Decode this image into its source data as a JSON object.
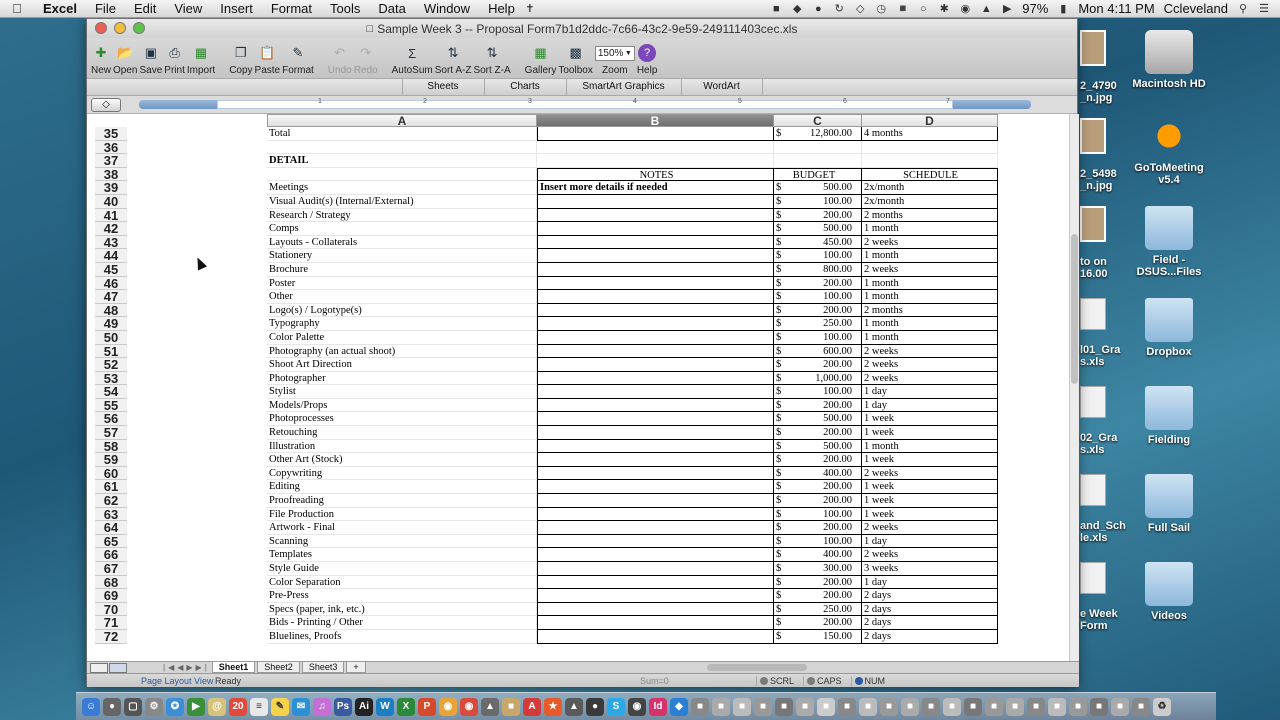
{
  "menubar": {
    "apple": "",
    "app": "Excel",
    "menus": [
      "File",
      "Edit",
      "View",
      "Insert",
      "Format",
      "Tools",
      "Data",
      "Window",
      "Help"
    ],
    "battery": "97%",
    "clock": "Mon 4:11 PM",
    "user": "Ccleveland"
  },
  "window": {
    "title": "Sample Week 3 -- Proposal Form7b1d2ddc-7c66-43c2-9e59-249111403cec.xls"
  },
  "toolbar": {
    "new": "New",
    "open": "Open",
    "save": "Save",
    "print": "Print",
    "import": "Import",
    "copy": "Copy",
    "paste": "Paste",
    "format": "Format",
    "undo": "Undo",
    "redo": "Redo",
    "autosum": "AutoSum",
    "sort_az": "Sort A-Z",
    "sort_za": "Sort Z-A",
    "gallery": "Gallery",
    "toolbox": "Toolbox",
    "zoom_value": "150%",
    "zoom": "Zoom",
    "help": "Help"
  },
  "ribbon_tabs": [
    "Sheets",
    "Charts",
    "SmartArt Graphics",
    "WordArt"
  ],
  "columns": [
    "A",
    "B",
    "C",
    "D"
  ],
  "rows": [
    {
      "n": "35",
      "a": "Total",
      "b": "",
      "cur": "$",
      "c": "12,800.00",
      "d": "4 months",
      "style": "box"
    },
    {
      "n": "36",
      "a": "",
      "b": "",
      "cur": "",
      "c": "",
      "d": "",
      "style": "plain"
    },
    {
      "n": "37",
      "a": "DETAIL",
      "b": "",
      "cur": "",
      "c": "",
      "d": "",
      "style": "plain",
      "bold_a": true
    },
    {
      "n": "38",
      "a": "",
      "b": "NOTES",
      "cur": "",
      "c": "BUDGET",
      "d": "SCHEDULE",
      "style": "hdr"
    },
    {
      "n": "39",
      "a": "Meetings",
      "b": "Insert more details if needed",
      "cur": "$",
      "c": "500.00",
      "d": "2x/month",
      "style": "box",
      "bold_b": true
    },
    {
      "n": "40",
      "a": "Visual Audit(s) (Internal/External)",
      "b": "",
      "cur": "$",
      "c": "100.00",
      "d": "2x/month",
      "style": "box"
    },
    {
      "n": "41",
      "a": "Research / Strategy",
      "b": "",
      "cur": "$",
      "c": "200.00",
      "d": "2 months",
      "style": "box"
    },
    {
      "n": "42",
      "a": "Comps",
      "b": "",
      "cur": "$",
      "c": "500.00",
      "d": "1 month",
      "style": "box"
    },
    {
      "n": "43",
      "a": "Layouts - Collaterals",
      "b": "",
      "cur": "$",
      "c": "450.00",
      "d": "2 weeks",
      "style": "box"
    },
    {
      "n": "44",
      "a": "Stationery",
      "b": "",
      "cur": "$",
      "c": "100.00",
      "d": "1 month",
      "style": "box"
    },
    {
      "n": "45",
      "a": "Brochure",
      "b": "",
      "cur": "$",
      "c": "800.00",
      "d": "2 weeks",
      "style": "box"
    },
    {
      "n": "46",
      "a": "Poster",
      "b": "",
      "cur": "$",
      "c": "200.00",
      "d": "1 month",
      "style": "box"
    },
    {
      "n": "47",
      "a": "Other",
      "b": "",
      "cur": "$",
      "c": "100.00",
      "d": "1 month",
      "style": "box"
    },
    {
      "n": "48",
      "a": "Logo(s) / Logotype(s)",
      "b": "",
      "cur": "$",
      "c": "200.00",
      "d": "2 months",
      "style": "box"
    },
    {
      "n": "49",
      "a": "Typography",
      "b": "",
      "cur": "$",
      "c": "250.00",
      "d": "1 month",
      "style": "box"
    },
    {
      "n": "50",
      "a": "Color Palette",
      "b": "",
      "cur": "$",
      "c": "100.00",
      "d": "1 month",
      "style": "box"
    },
    {
      "n": "51",
      "a": "Photography (an actual shoot)",
      "b": "",
      "cur": "$",
      "c": "600.00",
      "d": "2 weeks",
      "style": "box"
    },
    {
      "n": "52",
      "a": "Shoot Art Direction",
      "b": "",
      "cur": "$",
      "c": "200.00",
      "d": "2 weeks",
      "style": "box"
    },
    {
      "n": "53",
      "a": "Photographer",
      "b": "",
      "cur": "$",
      "c": "1,000.00",
      "d": "2 weeks",
      "style": "box"
    },
    {
      "n": "54",
      "a": "Stylist",
      "b": "",
      "cur": "$",
      "c": "100.00",
      "d": "1 day",
      "style": "box"
    },
    {
      "n": "55",
      "a": "Models/Props",
      "b": "",
      "cur": "$",
      "c": "200.00",
      "d": "1 day",
      "style": "box"
    },
    {
      "n": "56",
      "a": "Photoprocesses",
      "b": "",
      "cur": "$",
      "c": "500.00",
      "d": "1 week",
      "style": "box"
    },
    {
      "n": "57",
      "a": "Retouching",
      "b": "",
      "cur": "$",
      "c": "200.00",
      "d": "1 week",
      "style": "box"
    },
    {
      "n": "58",
      "a": "Illustration",
      "b": "",
      "cur": "$",
      "c": "500.00",
      "d": "1 month",
      "style": "box"
    },
    {
      "n": "59",
      "a": "Other Art (Stock)",
      "b": "",
      "cur": "$",
      "c": "200.00",
      "d": "1 week",
      "style": "box"
    },
    {
      "n": "60",
      "a": "Copywriting",
      "b": "",
      "cur": "$",
      "c": "400.00",
      "d": "2 weeks",
      "style": "box"
    },
    {
      "n": "61",
      "a": "Editing",
      "b": "",
      "cur": "$",
      "c": "200.00",
      "d": "1 week",
      "style": "box"
    },
    {
      "n": "62",
      "a": "Proofreading",
      "b": "",
      "cur": "$",
      "c": "200.00",
      "d": "1 week",
      "style": "box"
    },
    {
      "n": "63",
      "a": "File Production",
      "b": "",
      "cur": "$",
      "c": "100.00",
      "d": "1 week",
      "style": "box"
    },
    {
      "n": "64",
      "a": "Artwork - Final",
      "b": "",
      "cur": "$",
      "c": "200.00",
      "d": "2 weeks",
      "style": "box"
    },
    {
      "n": "65",
      "a": "Scanning",
      "b": "",
      "cur": "$",
      "c": "100.00",
      "d": "1 day",
      "style": "box"
    },
    {
      "n": "66",
      "a": "Templates",
      "b": "",
      "cur": "$",
      "c": "400.00",
      "d": "2 weeks",
      "style": "box"
    },
    {
      "n": "67",
      "a": "Style Guide",
      "b": "",
      "cur": "$",
      "c": "300.00",
      "d": "3 weeks",
      "style": "box"
    },
    {
      "n": "68",
      "a": "Color Separation",
      "b": "",
      "cur": "$",
      "c": "200.00",
      "d": "1 day",
      "style": "box"
    },
    {
      "n": "69",
      "a": "Pre-Press",
      "b": "",
      "cur": "$",
      "c": "200.00",
      "d": "2 days",
      "style": "box"
    },
    {
      "n": "70",
      "a": "Specs (paper, ink, etc.)",
      "b": "",
      "cur": "$",
      "c": "250.00",
      "d": "2 days",
      "style": "box"
    },
    {
      "n": "71",
      "a": "Bids - Printing / Other",
      "b": "",
      "cur": "$",
      "c": "200.00",
      "d": "2 days",
      "style": "box"
    },
    {
      "n": "72",
      "a": "Bluelines, Proofs",
      "b": "",
      "cur": "$",
      "c": "150.00",
      "d": "2 days",
      "style": "box"
    }
  ],
  "sheet_tabs": [
    "Sheet1",
    "Sheet2",
    "Sheet3"
  ],
  "status": {
    "view": "Page Layout View",
    "ready": "Ready",
    "sum": "Sum=0",
    "scrl": "SCRL",
    "caps": "CAPS",
    "num": "NUM"
  },
  "desktop": {
    "items": [
      "Macintosh HD",
      "GoToMeeting v5.4",
      "Field - DSUS...Files",
      "Dropbox",
      "Fielding",
      "Full Sail",
      "Videos"
    ],
    "edge_labels": [
      "2_4790\n_n.jpg",
      "2_5498\n_n.jpg",
      "to on\n16.00",
      "l01_Gra\ns.xls",
      "02_Gra\ns.xls",
      "and_Sch\nle.xls",
      "e Week\nForm"
    ]
  },
  "colors": {
    "accent": "#2b5aa3",
    "selected_col": "#7a7a7a"
  }
}
